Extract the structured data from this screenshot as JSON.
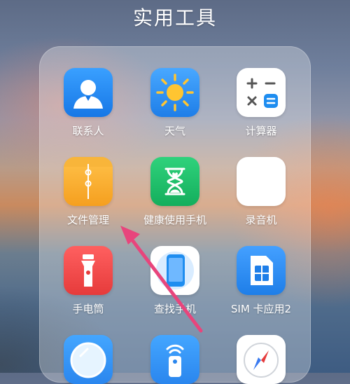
{
  "folder": {
    "title": "实用工具",
    "apps": [
      {
        "label": "联系人",
        "icon": "contacts-icon"
      },
      {
        "label": "天气",
        "icon": "weather-sun-icon"
      },
      {
        "label": "计算器",
        "icon": "calculator-icon"
      },
      {
        "label": "文件管理",
        "icon": "file-manager-icon"
      },
      {
        "label": "健康使用手机",
        "icon": "hourglass-icon"
      },
      {
        "label": "录音机",
        "icon": "recorder-icon"
      },
      {
        "label": "手电筒",
        "icon": "flashlight-icon"
      },
      {
        "label": "查找手机",
        "icon": "find-phone-icon"
      },
      {
        "label": "SIM 卡应用2",
        "icon": "sim-card-icon"
      },
      {
        "label": "",
        "icon": "mirror-icon"
      },
      {
        "label": "",
        "icon": "remote-control-icon"
      },
      {
        "label": "",
        "icon": "compass-icon"
      }
    ]
  },
  "colors": {
    "contacts": "#1e8df0",
    "weather": "#2f8ff2",
    "calculator": "#ffffff",
    "file_manager": "#f6a623",
    "health": "#20c06a",
    "recorder": "#ffffff",
    "flashlight": "#ef4a4a",
    "find_phone": "#ffffff",
    "sim": "#2a8df2",
    "annotation_arrow": "#e8457c"
  }
}
